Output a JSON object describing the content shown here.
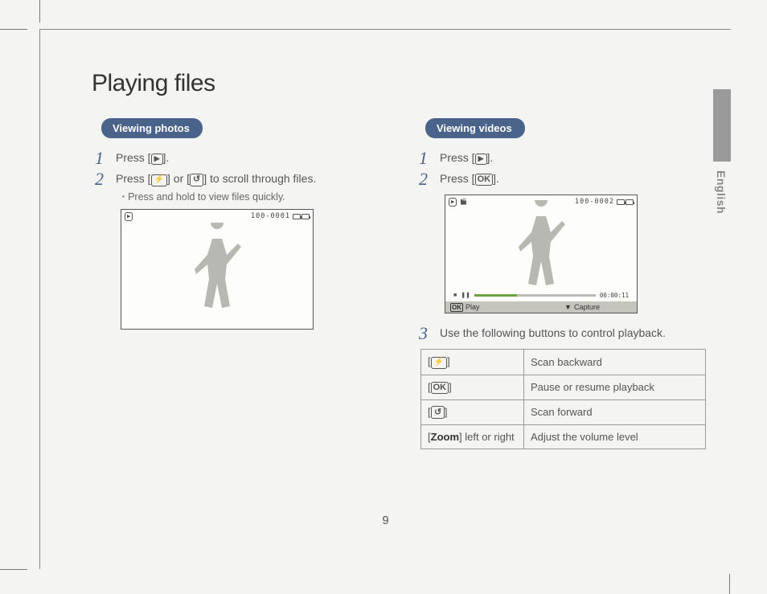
{
  "page": {
    "title": "Playing files",
    "number": "9",
    "side_label": "English"
  },
  "left": {
    "heading": "Viewing photos",
    "step1": {
      "pre": "Press [",
      "post": "]."
    },
    "step2": {
      "pre": "Press [",
      "mid": "] or [",
      "post": "] to scroll through files."
    },
    "sub": "Press and hold to view files quickly.",
    "screen": {
      "counter": "100-0001"
    }
  },
  "right": {
    "heading": "Viewing videos",
    "step1": {
      "pre": "Press [",
      "post": "]."
    },
    "step2": {
      "pre": "Press [",
      "post": "]."
    },
    "screen": {
      "counter": "100-0002",
      "time": "00:00:11",
      "play": "Play",
      "capture": "Capture"
    },
    "step3": "Use the following buttons to control playback.",
    "table": {
      "rows": [
        {
          "desc": "Scan backward"
        },
        {
          "desc": "Pause or resume playback"
        },
        {
          "desc": "Scan forward"
        },
        {
          "key_zoom": "Zoom",
          "key_rest": " left or right",
          "desc": "Adjust the volume level"
        }
      ]
    }
  },
  "icons": {
    "playback": "▶",
    "ok": "OK",
    "pause": "❚❚",
    "stop": "■",
    "down": "▼"
  }
}
